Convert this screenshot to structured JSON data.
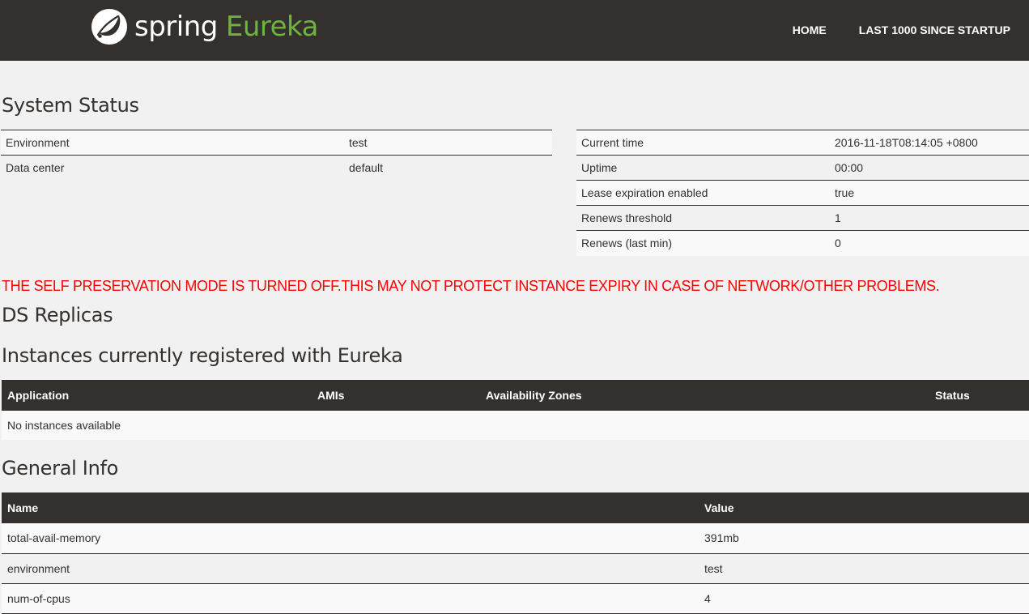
{
  "brand": {
    "spring": "spring",
    "eureka": "Eureka",
    "accent_color": "#6db33f"
  },
  "nav": {
    "home": "HOME",
    "last1000": "LAST 1000 SINCE STARTUP"
  },
  "system_status": {
    "title": "System Status",
    "left": [
      {
        "label": "Environment",
        "value": "test"
      },
      {
        "label": "Data center",
        "value": "default"
      }
    ],
    "right": [
      {
        "label": "Current time",
        "value": "2016-11-18T08:14:05 +0800"
      },
      {
        "label": "Uptime",
        "value": "00:00"
      },
      {
        "label": "Lease expiration enabled",
        "value": "true"
      },
      {
        "label": "Renews threshold",
        "value": "1"
      },
      {
        "label": "Renews (last min)",
        "value": "0"
      }
    ]
  },
  "warning": "THE SELF PRESERVATION MODE IS TURNED OFF.THIS MAY NOT PROTECT INSTANCE EXPIRY IN CASE OF NETWORK/OTHER PROBLEMS.",
  "warning_color": "#ff0000",
  "ds_replicas": {
    "title": "DS Replicas"
  },
  "instances": {
    "title": "Instances currently registered with Eureka",
    "headers": [
      "Application",
      "AMIs",
      "Availability Zones",
      "Status"
    ],
    "empty_text": "No instances available"
  },
  "general_info": {
    "title": "General Info",
    "headers": [
      "Name",
      "Value"
    ],
    "rows": [
      {
        "name": "total-avail-memory",
        "value": "391mb"
      },
      {
        "name": "environment",
        "value": "test"
      },
      {
        "name": "num-of-cpus",
        "value": "4"
      }
    ]
  }
}
